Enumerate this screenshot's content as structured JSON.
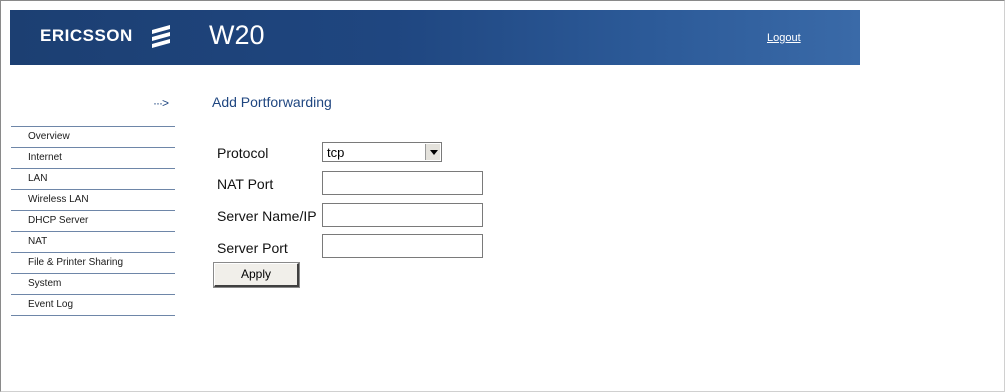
{
  "header": {
    "brand": "ERICSSON",
    "brand_logo_icon": "ericsson-logo-icon",
    "product": "W20",
    "logout_label": "Logout",
    "colors": {
      "banner_dark": "#1c3f72",
      "banner_light": "#3a6aa8",
      "accent_text": "#1f4680"
    }
  },
  "nav": {
    "arrow": "···>",
    "items": [
      {
        "label": "Overview"
      },
      {
        "label": "Internet"
      },
      {
        "label": "LAN"
      },
      {
        "label": "Wireless LAN"
      },
      {
        "label": "DHCP Server"
      },
      {
        "label": "NAT"
      },
      {
        "label": "File & Printer Sharing"
      },
      {
        "label": "System"
      },
      {
        "label": "Event Log"
      }
    ]
  },
  "main": {
    "title": "Add Portforwarding",
    "form": {
      "protocol_label": "Protocol",
      "protocol_value": "tcp",
      "nat_port_label": "NAT Port",
      "nat_port_value": "",
      "server_label": "Server Name/IP",
      "server_value": "",
      "server_port_label": "Server Port",
      "server_port_value": "",
      "apply_label": "Apply"
    }
  }
}
